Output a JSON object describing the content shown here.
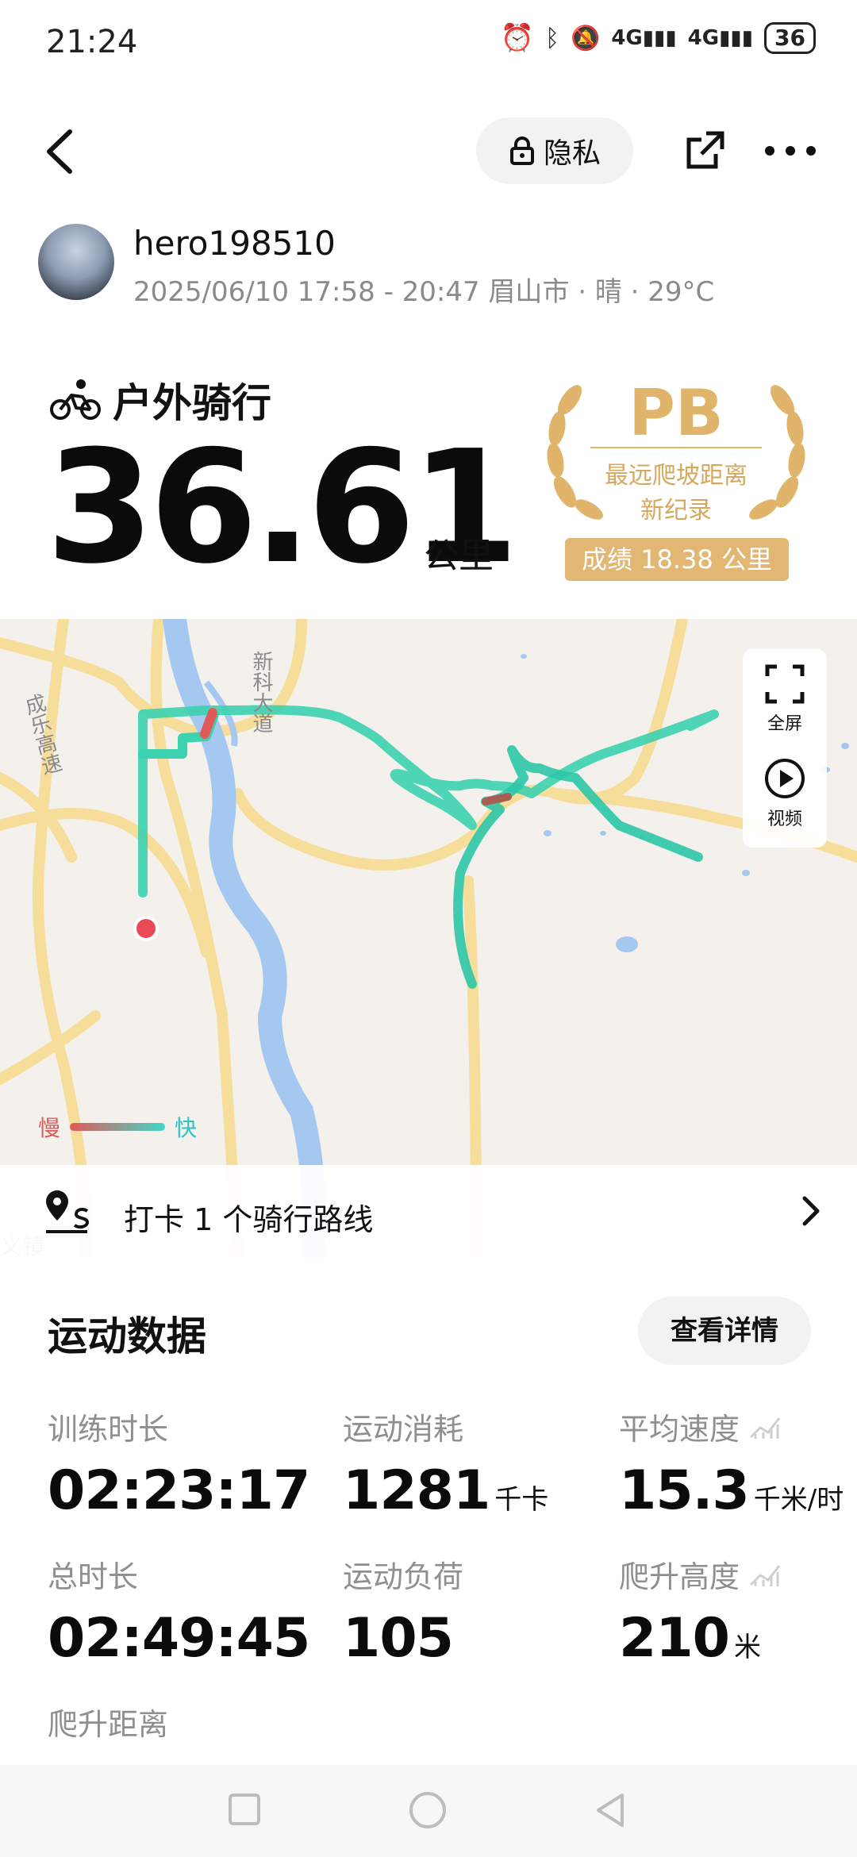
{
  "status_bar": {
    "time": "21:24",
    "battery": "36"
  },
  "topnav": {
    "privacy_label": "隐私"
  },
  "user": {
    "name": "hero198510",
    "meta": "2025/06/10 17:58 - 20:47 眉山市 · 晴 · 29°C"
  },
  "activity": {
    "type": "户外骑行",
    "distance": "36.61",
    "distance_unit": "公里"
  },
  "pb_badge": {
    "label": "PB",
    "line1": "最远爬坡距离",
    "line2": "新纪录",
    "score": "成绩 18.38 公里",
    "color": "#e2b774"
  },
  "map": {
    "road_label_1": "新科大道",
    "road_label_2": "成乐高速",
    "fullscreen_label": "全屏",
    "video_label": "视频",
    "legend_slow": "慢",
    "legend_fast": "快",
    "corner_label": "义镇"
  },
  "checkin": {
    "text": "打卡 1 个骑行路线"
  },
  "stats_section": {
    "title": "运动数据",
    "details_button": "查看详情",
    "items": [
      {
        "label": "训练时长",
        "value": "02:23:17",
        "unit": ""
      },
      {
        "label": "运动消耗",
        "value": "1281",
        "unit": "千卡"
      },
      {
        "label": "平均速度",
        "value": "15.3",
        "unit": "千米/时"
      },
      {
        "label": "总时长",
        "value": "02:49:45",
        "unit": ""
      },
      {
        "label": "运动负荷",
        "value": "105",
        "unit": ""
      },
      {
        "label": "爬升高度",
        "value": "210",
        "unit": "米"
      },
      {
        "label": "爬升距离",
        "value": "",
        "unit": ""
      }
    ]
  },
  "colors": {
    "route_fast": "#41d8c8",
    "route_slow": "#e05a5a",
    "accent_gold": "#e0b46a"
  }
}
